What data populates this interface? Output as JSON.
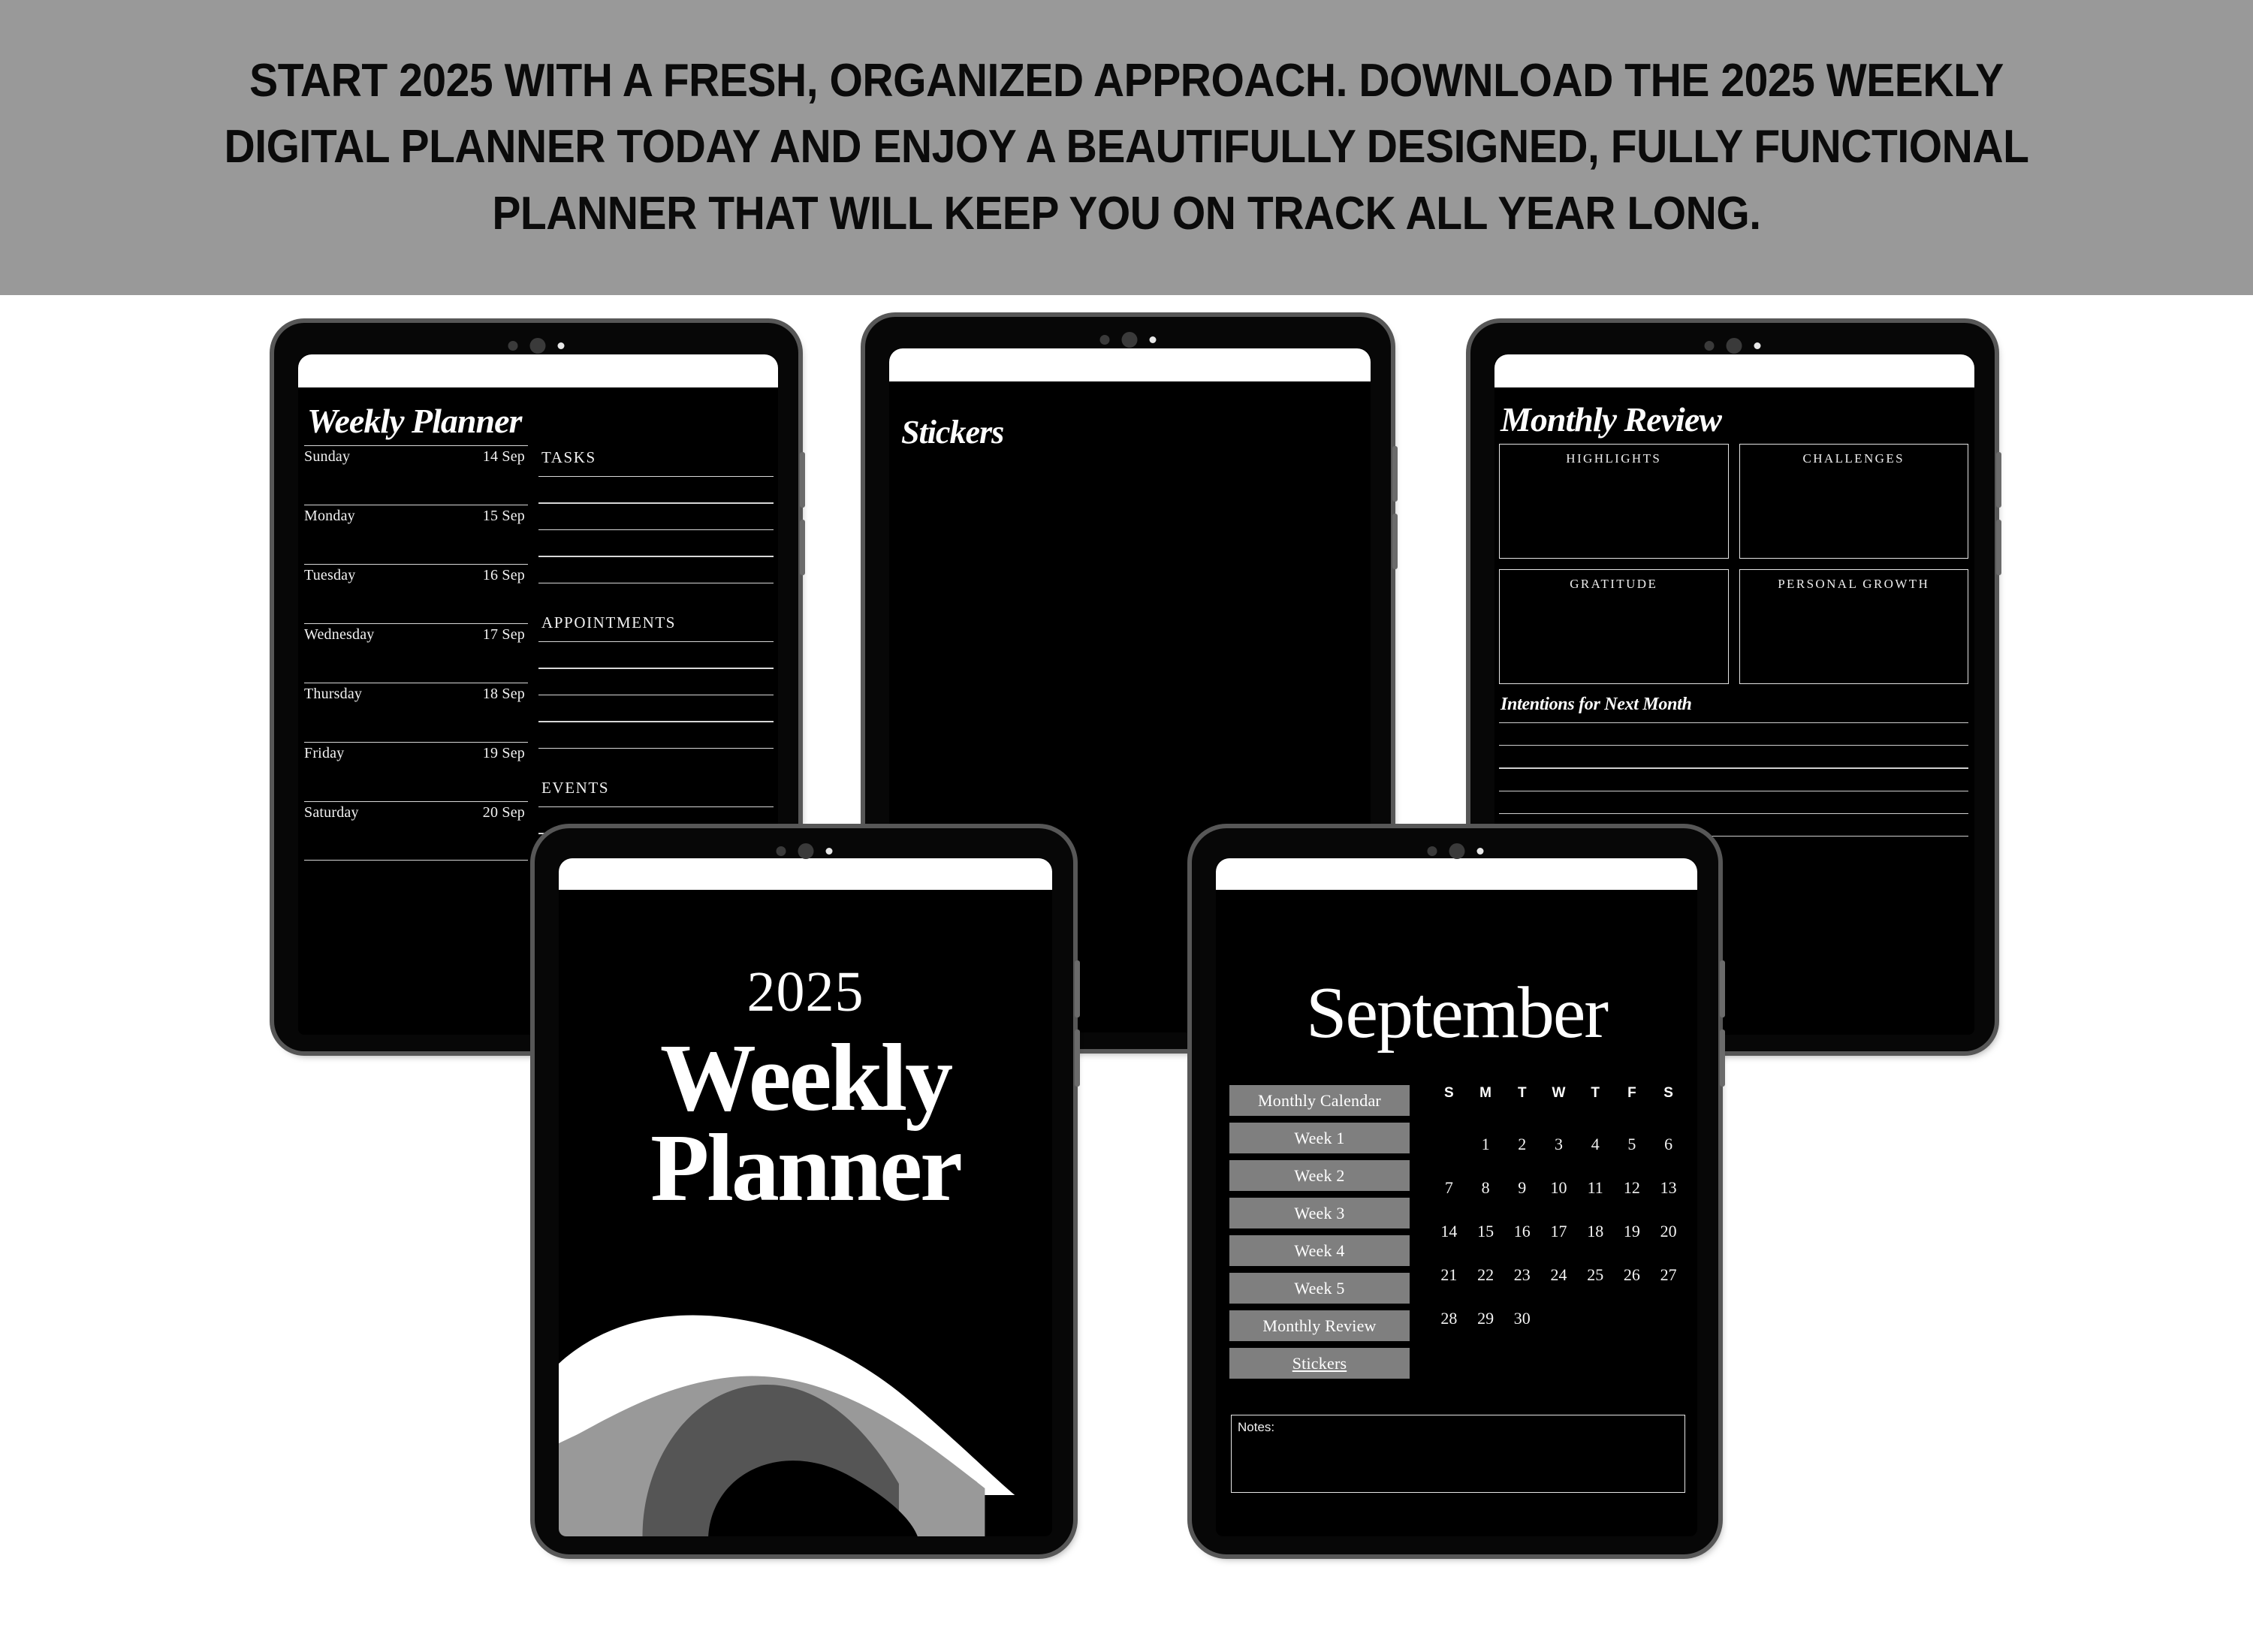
{
  "promo": {
    "headline": "START 2025 WITH A FRESH, ORGANIZED APPROACH. DOWNLOAD THE 2025 WEEKLY DIGITAL PLANNER TODAY AND ENJOY A BEAUTIFULLY DESIGNED, FULLY FUNCTIONAL PLANNER THAT WILL KEEP YOU ON TRACK ALL YEAR LONG.",
    "band_color": "#999999",
    "text_color": "#000000"
  },
  "weekly_page": {
    "title": "Weekly Planner",
    "days": [
      {
        "name": "Sunday",
        "date": "14 Sep"
      },
      {
        "name": "Monday",
        "date": "15 Sep"
      },
      {
        "name": "Tuesday",
        "date": "16 Sep"
      },
      {
        "name": "Wednesday",
        "date": "17 Sep"
      },
      {
        "name": "Thursday",
        "date": "18 Sep"
      },
      {
        "name": "Friday",
        "date": "19 Sep"
      },
      {
        "name": "Saturday",
        "date": "20 Sep"
      }
    ],
    "sections": {
      "tasks": "TASKS",
      "appointments": "APPOINTMENTS",
      "events": "EVENTS"
    }
  },
  "stickers_page": {
    "title": "Stickers"
  },
  "monthly_review_page": {
    "title": "Monthly Review",
    "boxes": [
      "HIGHLIGHTS",
      "CHALLENGES",
      "GRATITUDE",
      "PERSONAL GROWTH"
    ],
    "intentions_label": "Intentions for Next Month"
  },
  "cover_page": {
    "year": "2025",
    "line1": "Weekly",
    "line2": "Planner",
    "wave_colors": {
      "top": "#ffffff",
      "middle": "#999999",
      "inner": "#555555",
      "background": "#000000"
    }
  },
  "september_page": {
    "title": "September",
    "nav_items": [
      {
        "label": "Monthly Calendar",
        "underlined": false
      },
      {
        "label": "Week 1",
        "underlined": false
      },
      {
        "label": "Week 2",
        "underlined": false
      },
      {
        "label": "Week 3",
        "underlined": false
      },
      {
        "label": "Week 4",
        "underlined": false
      },
      {
        "label": "Week 5",
        "underlined": false
      },
      {
        "label": "Monthly Review",
        "underlined": false
      },
      {
        "label": "Stickers",
        "underlined": true
      }
    ],
    "nav_button_color": "#7f7f7f",
    "calendar": {
      "weekday_headers": [
        "S",
        "M",
        "T",
        "W",
        "T",
        "F",
        "S"
      ],
      "weeks": [
        [
          "",
          "1",
          "2",
          "3",
          "4",
          "5",
          "6"
        ],
        [
          "7",
          "8",
          "9",
          "10",
          "11",
          "12",
          "13"
        ],
        [
          "14",
          "15",
          "16",
          "17",
          "18",
          "19",
          "20"
        ],
        [
          "21",
          "22",
          "23",
          "24",
          "25",
          "26",
          "27"
        ],
        [
          "28",
          "29",
          "30",
          "",
          "",
          "",
          ""
        ]
      ]
    },
    "notes_label": "Notes:"
  }
}
